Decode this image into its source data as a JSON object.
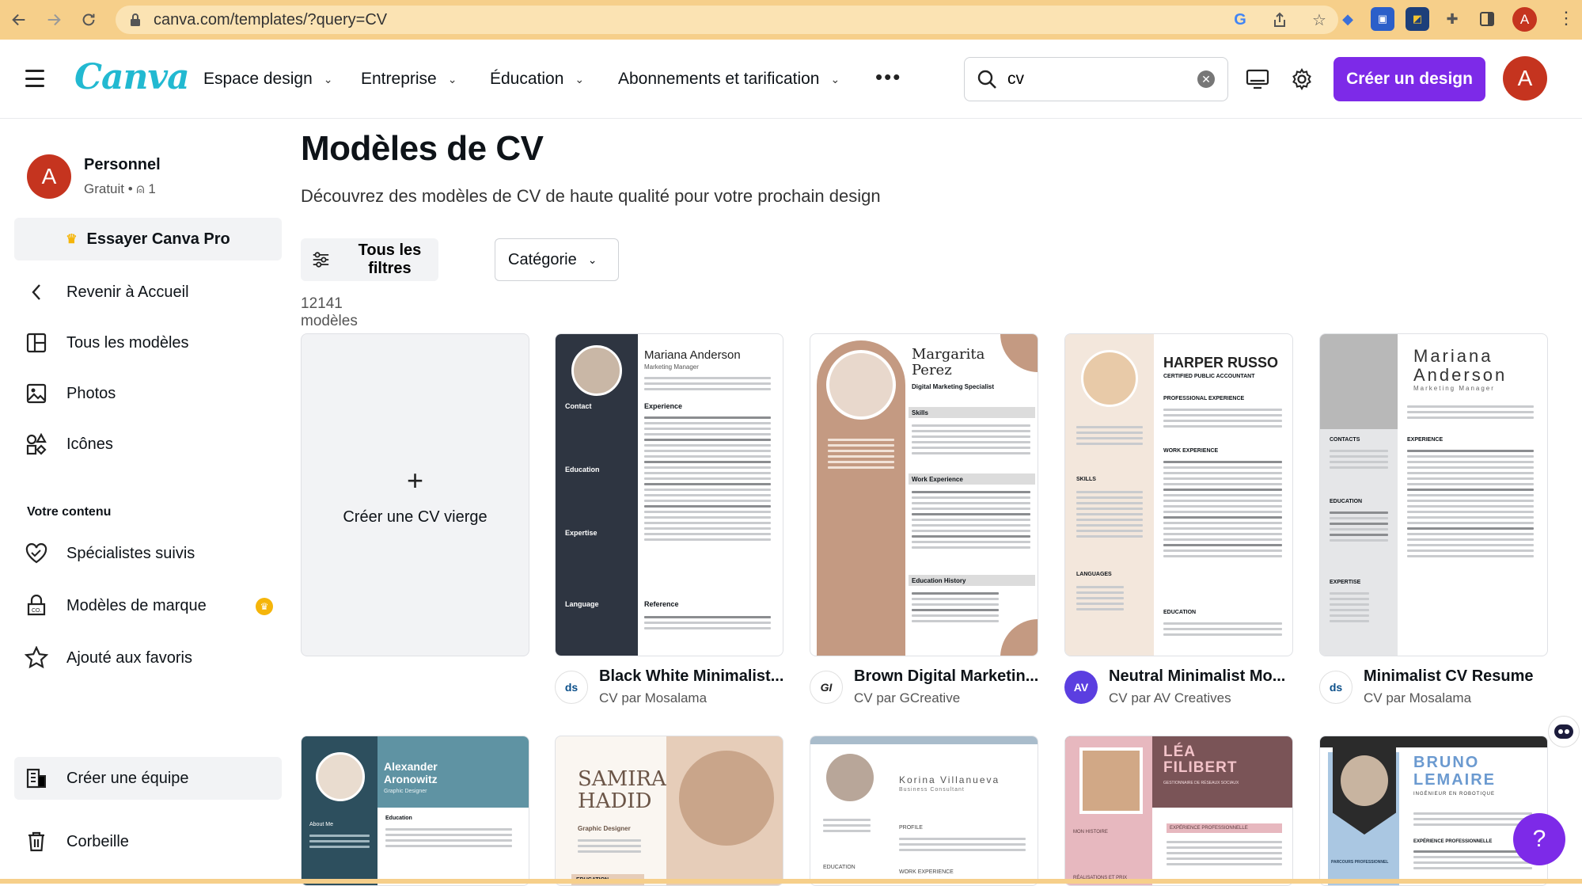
{
  "browser": {
    "url": "canva.com/templates/?query=CV",
    "profile_initial": "A"
  },
  "header": {
    "logo": "Canva",
    "menu": [
      {
        "label": "Espace design"
      },
      {
        "label": "Entreprise"
      },
      {
        "label": "Éducation"
      },
      {
        "label": "Abonnements et tarification"
      }
    ],
    "search_value": "cv",
    "create_label": "Créer un design",
    "avatar_initial": "A"
  },
  "sidebar": {
    "user_initial": "A",
    "user_name": "Personnel",
    "user_plan": "Gratuit • ",
    "user_members": "1",
    "pro_label": "Essayer Canva Pro",
    "nav": [
      {
        "label": "Revenir à Accueil"
      },
      {
        "label": "Tous les modèles"
      },
      {
        "label": "Photos"
      },
      {
        "label": "Icônes"
      }
    ],
    "section_title": "Votre contenu",
    "content_items": [
      {
        "label": "Spécialistes suivis"
      },
      {
        "label": "Modèles de marque"
      },
      {
        "label": "Ajouté aux favoris"
      }
    ],
    "team_label": "Créer une équipe",
    "trash_label": "Corbeille"
  },
  "main": {
    "title": "Modèles de CV",
    "subtitle": "Découvrez des modèles de CV de haute qualité pour votre prochain design",
    "filters_label": "Tous les filtres",
    "category_label": "Catégorie",
    "count_label": "12141 modèles",
    "blank_label": "Créer une CV vierge",
    "templates": [
      {
        "title": "Black White Minimalist...",
        "author": "CV par Mosalama",
        "logo": "ds",
        "preview": {
          "name": "Mariana Anderson",
          "role": "Marketing Manager",
          "sections": [
            "Contact",
            "Education",
            "Expertise",
            "Language",
            "Experience",
            "Reference"
          ]
        }
      },
      {
        "title": "Brown Digital Marketin...",
        "author": "CV par GCreative",
        "logo": "GI",
        "preview": {
          "name": "Margarita Perez",
          "role": "Digital Marketing Specialist",
          "sections": [
            "Skills",
            "Work Experience",
            "Education History"
          ]
        }
      },
      {
        "title": "Neutral Minimalist Mo...",
        "author": "CV par AV Creatives",
        "logo": "AV",
        "preview": {
          "name": "HARPER RUSSO",
          "role": "CERTIFIED PUBLIC ACCOUNTANT",
          "sections": [
            "PROFESSIONAL EXPERIENCE",
            "WORK EXPERIENCE",
            "SKILLS",
            "LANGUAGES",
            "EDUCATION"
          ]
        }
      },
      {
        "title": "Minimalist CV Resume",
        "author": "CV par Mosalama",
        "logo": "ds",
        "preview": {
          "name": "Mariana Anderson",
          "role": "Marketing Manager",
          "sections": [
            "CONTACTS",
            "EXPERIENCE",
            "EDUCATION",
            "EXPERTISE"
          ]
        }
      }
    ],
    "templates_row2": [
      {
        "name": "Alexander Aronowitz",
        "role": "Graphic Designer",
        "sections": [
          "About Me",
          "Education"
        ]
      },
      {
        "name": "SAMIRA HADID",
        "role": "Graphic Designer",
        "sections": [
          "EDUCATION"
        ]
      },
      {
        "name": "Korina Villanueva",
        "role": "Business Consultant",
        "sections": [
          "PROFILE",
          "EDUCATION",
          "WORK EXPERIENCE"
        ]
      },
      {
        "name": "LÉA FILIBERT",
        "role": "GESTIONNAIRE DE RÉSEAUX SOCIAUX",
        "sections": [
          "EXPÉRIENCE PROFESSIONNELLE",
          "MON HISTOIRE",
          "RÉALISATIONS ET PRIX"
        ]
      },
      {
        "name": "BRUNO LEMAIRE",
        "role": "INGÉNIEUR EN ROBOTIQUE",
        "sections": [
          "EXPÉRIENCE PROFESSIONNELLE",
          "PARCOURS PROFESSIONNEL"
        ]
      }
    ]
  }
}
